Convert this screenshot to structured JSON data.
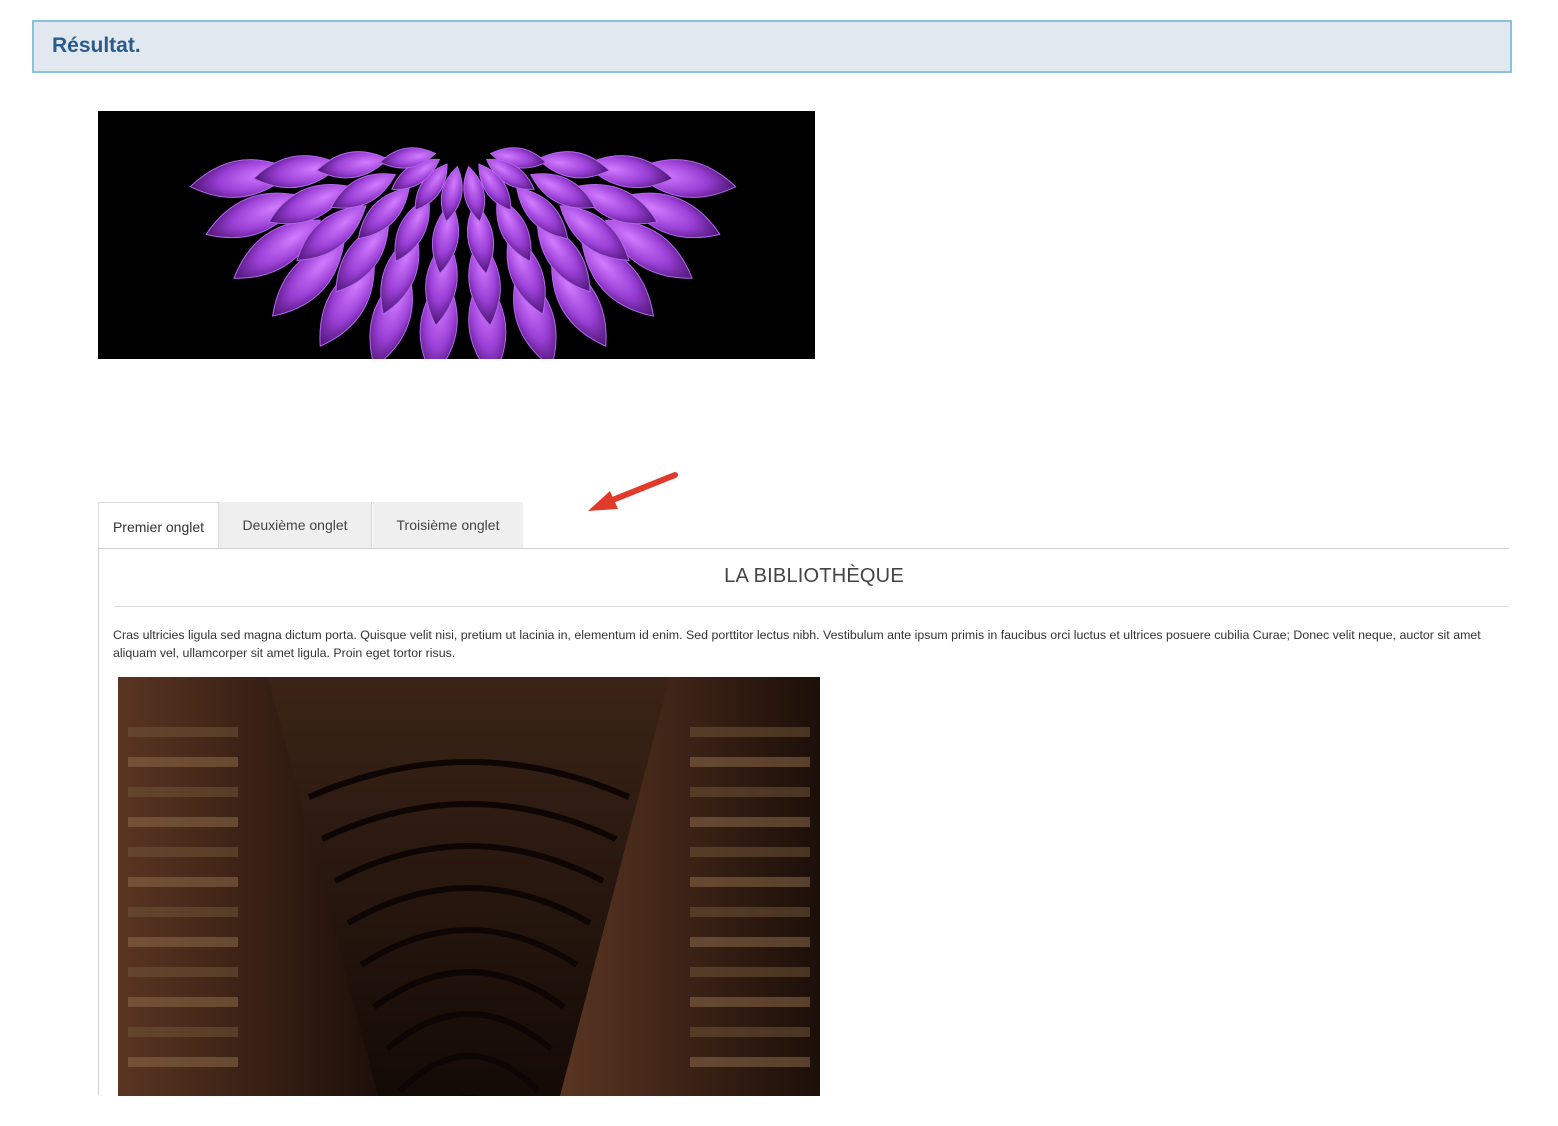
{
  "header": {
    "title": "Résultat."
  },
  "banner": {
    "alt": "purple flower image"
  },
  "tabs": [
    {
      "label": "Premier onglet",
      "active": true
    },
    {
      "label": "Deuxième onglet",
      "active": false
    },
    {
      "label": "Troisième onglet",
      "active": false
    }
  ],
  "panel": {
    "title": "LA BIBLIOTHÈQUE",
    "text": "Cras ultricies ligula sed magna dictum porta. Quisque velit nisi, pretium ut lacinia in, elementum id enim. Sed porttitor lectus nibh. Vestibulum ante ipsum primis in faucibus orci luctus et ultrices posuere cubilia Curae; Donec velit neque, auctor sit amet aliquam vel, ullamcorper sit amet ligula. Proin eget tortor risus."
  },
  "colors": {
    "header_bg": "#e2e8ef",
    "header_border": "#84c3d9",
    "header_text": "#2a5b8c",
    "arrow": "#e23a2a"
  }
}
